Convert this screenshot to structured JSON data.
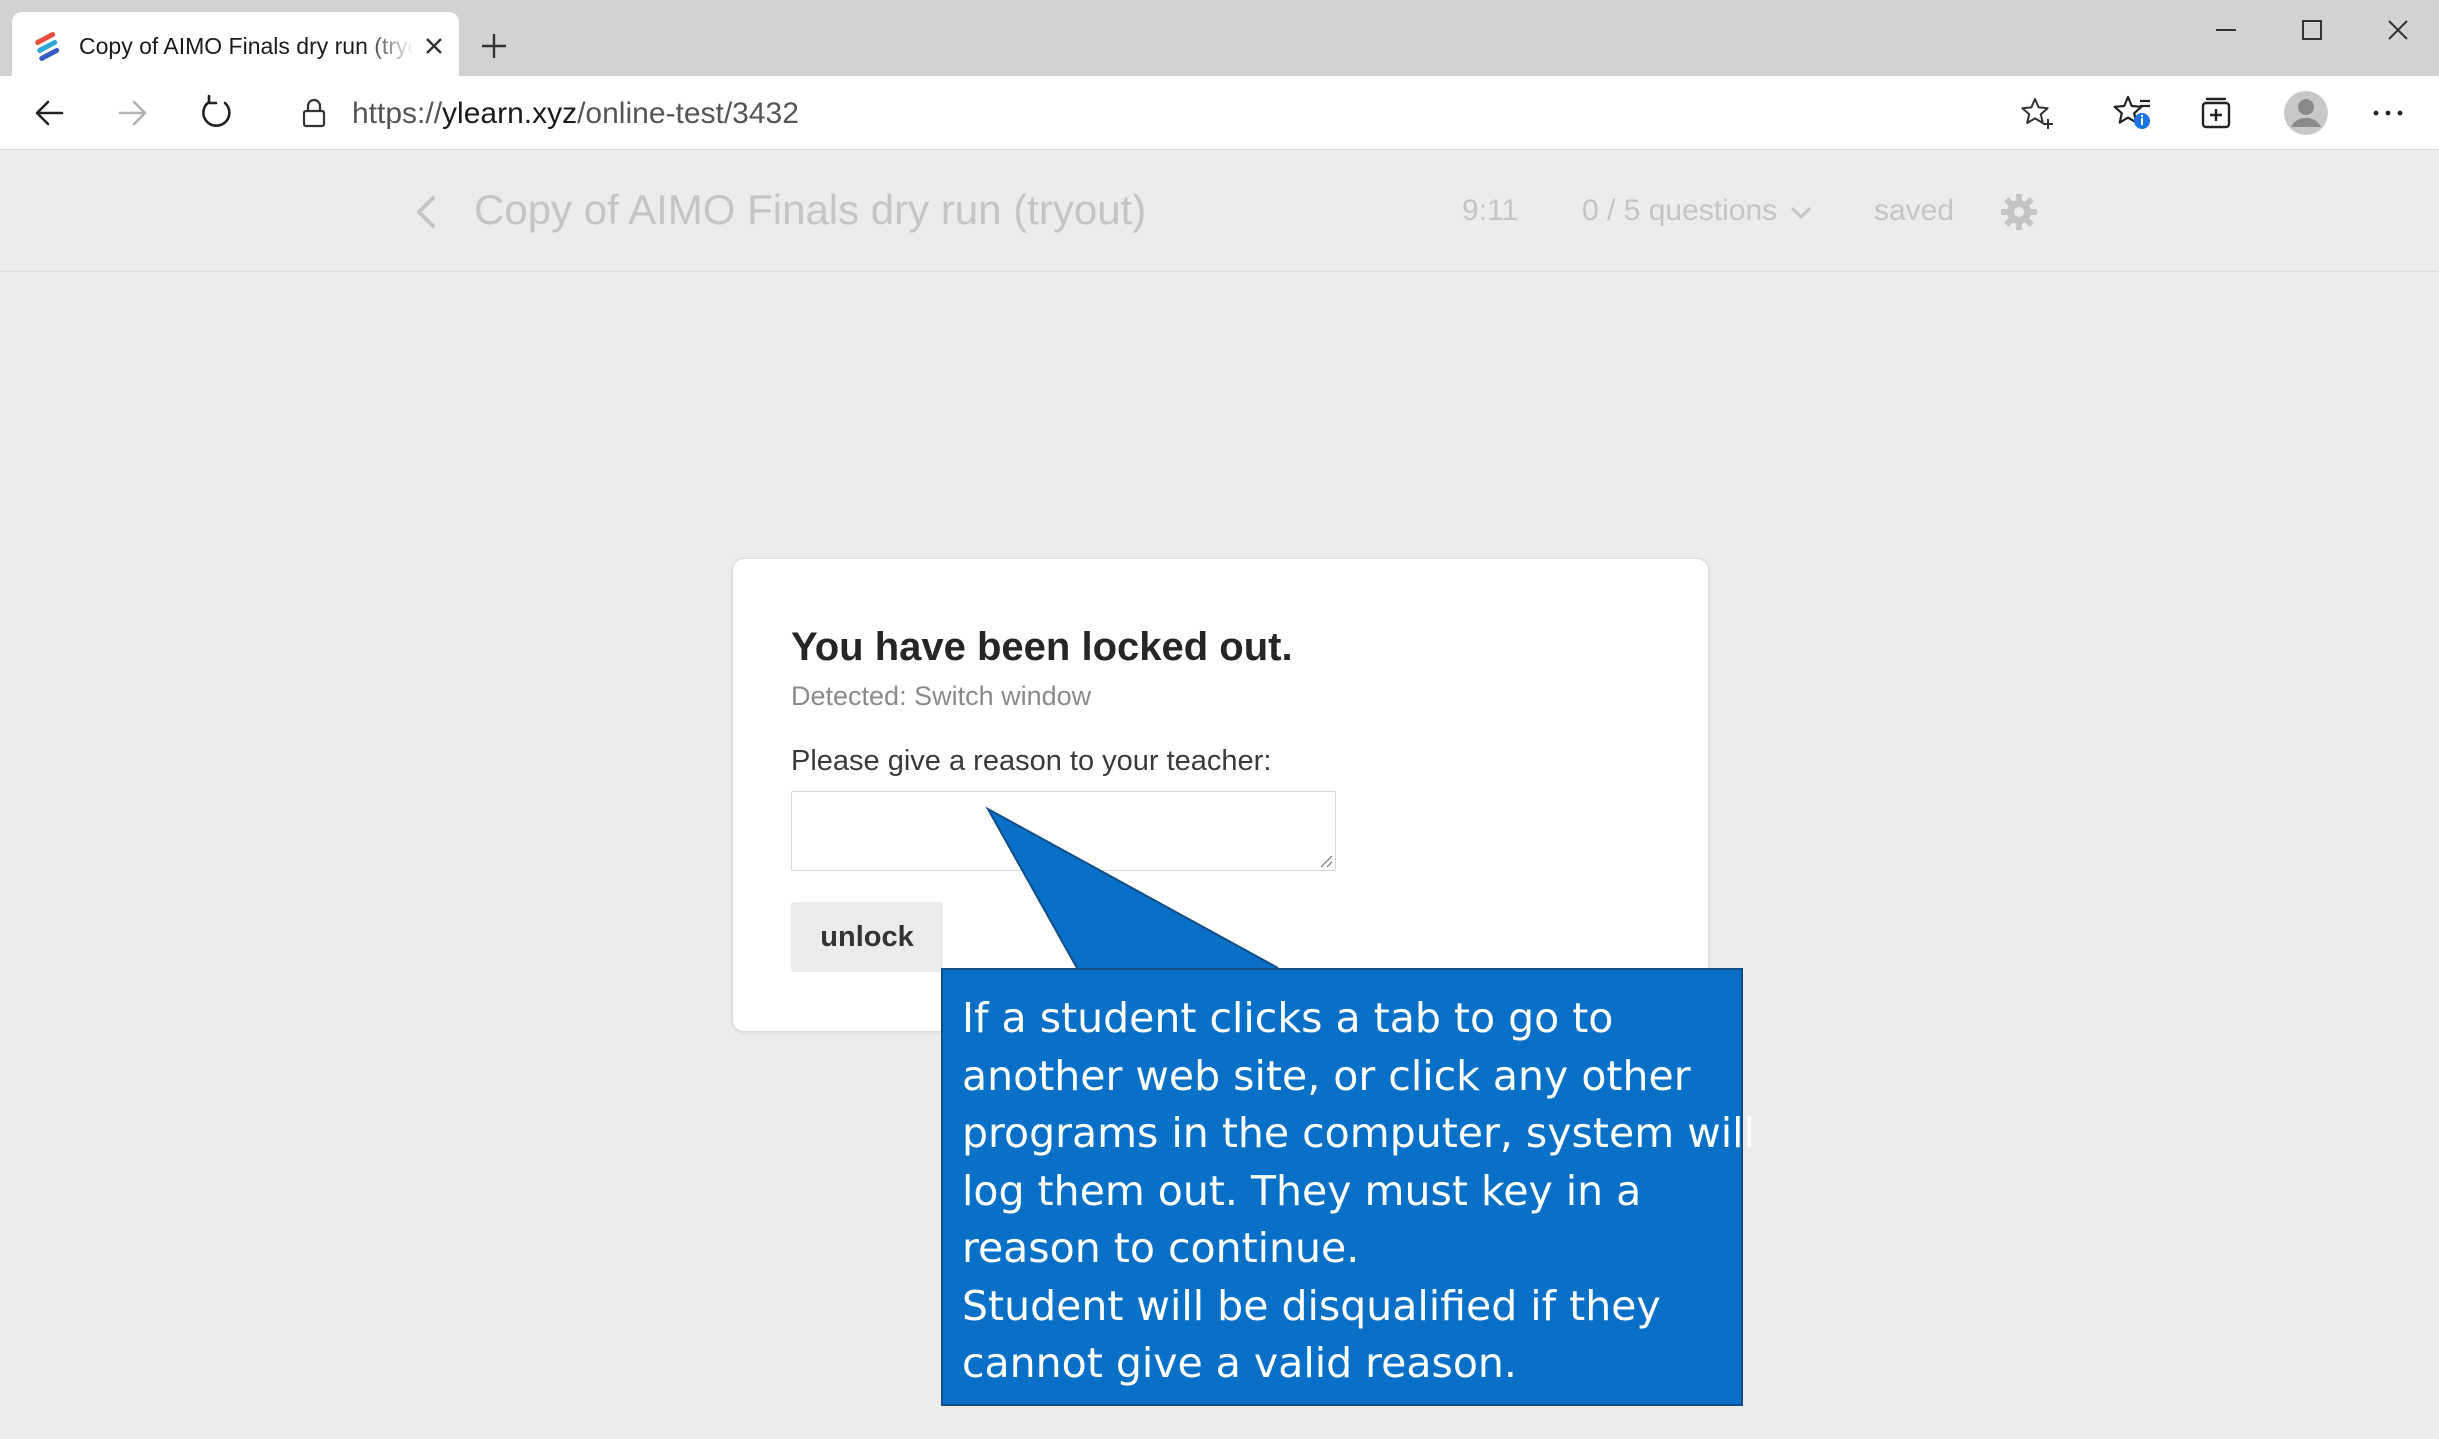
{
  "browser": {
    "tab": {
      "title": "Copy of AIMO Finals dry run (tryout)",
      "favicon": "ylearn-stripes-icon",
      "favicon_colors": [
        "#e84c3d",
        "#2fa8d6",
        "#3a5bc7"
      ]
    },
    "window_controls": [
      "minimize-icon",
      "maximize-icon",
      "close-icon"
    ],
    "address": {
      "scheme": "https://",
      "host": "ylearn.xyz",
      "path": "/online-test/3432"
    },
    "favorites_badge_color": "#1a73e8"
  },
  "header": {
    "title": "Copy of AIMO Finals dry run (tryout)",
    "timer": "9:11",
    "progress": "0 / 5 questions",
    "save_status": "saved"
  },
  "lock_dialog": {
    "title": "You have been locked out.",
    "detected": "Detected: Switch window",
    "prompt": "Please give a reason to your teacher:",
    "reason_value": "",
    "unlock_label": "unlock"
  },
  "callout": {
    "background": "#0870c6",
    "lines": [
      "If a student clicks a tab to go to",
      "another web site, or click any other",
      "programs in the computer, system will",
      "log them out. They must key in a",
      "reason to continue.",
      "Student will be disqualified if they",
      "cannot give a valid reason."
    ]
  }
}
